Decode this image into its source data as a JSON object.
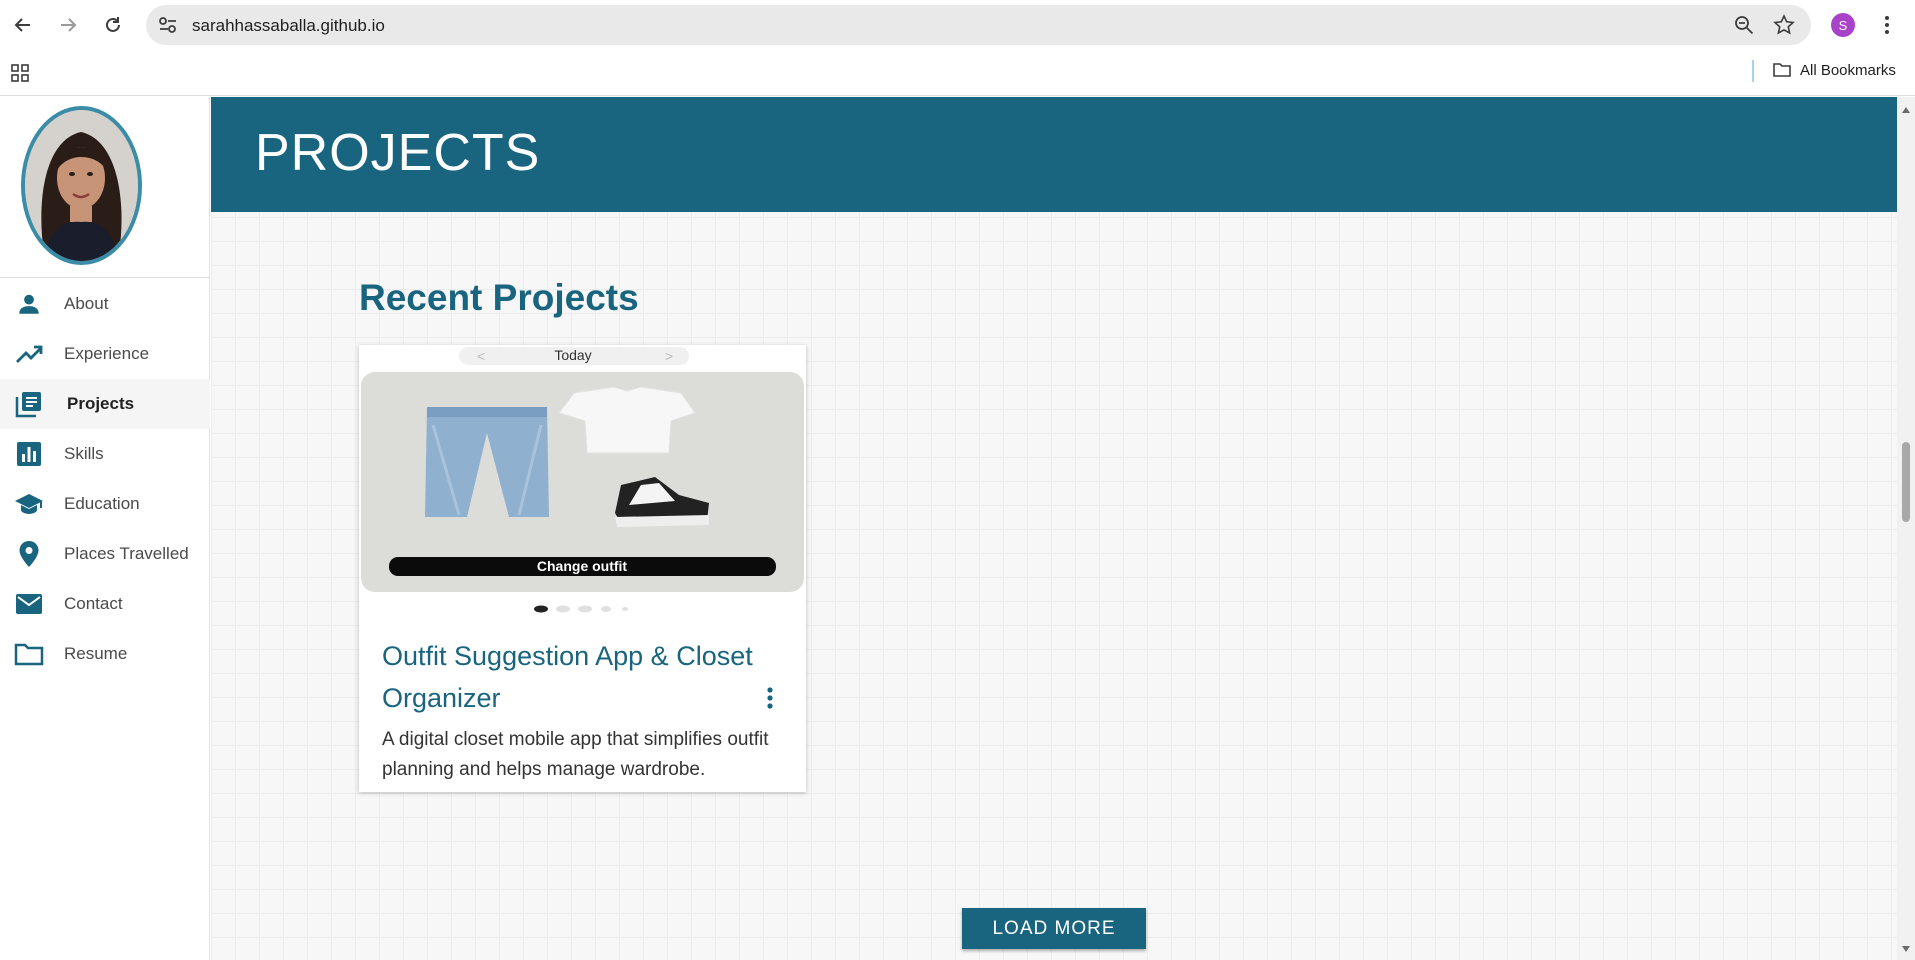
{
  "browser": {
    "url": "sarahhassaballa.github.io",
    "profile_initial": "S",
    "bookmarks_label": "All Bookmarks"
  },
  "sidebar": {
    "items": [
      {
        "label": "About",
        "icon": "person-icon"
      },
      {
        "label": "Experience",
        "icon": "trending-up-icon"
      },
      {
        "label": "Projects",
        "icon": "library-books-icon",
        "active": true
      },
      {
        "label": "Skills",
        "icon": "bar-chart-icon"
      },
      {
        "label": "Education",
        "icon": "school-icon"
      },
      {
        "label": "Places Travelled",
        "icon": "location-pin-icon"
      },
      {
        "label": "Contact",
        "icon": "mail-icon"
      },
      {
        "label": "Resume",
        "icon": "folder-icon"
      }
    ]
  },
  "banner": {
    "title": "PROJECTS"
  },
  "section": {
    "title": "Recent Projects"
  },
  "project_card": {
    "image": {
      "header": "Today",
      "button": "Change outfit",
      "carousel_count": 5,
      "carousel_active": 0
    },
    "title": "Outfit Suggestion App & Closet Organizer",
    "description": "A digital closet mobile app that simplifies outfit planning and helps manage wardrobe."
  },
  "load_more": {
    "label": "LOAD MORE"
  },
  "colors": {
    "primary": "#19647e",
    "avatar_ring": "#3b8ca7",
    "profile": "#a742c9"
  }
}
